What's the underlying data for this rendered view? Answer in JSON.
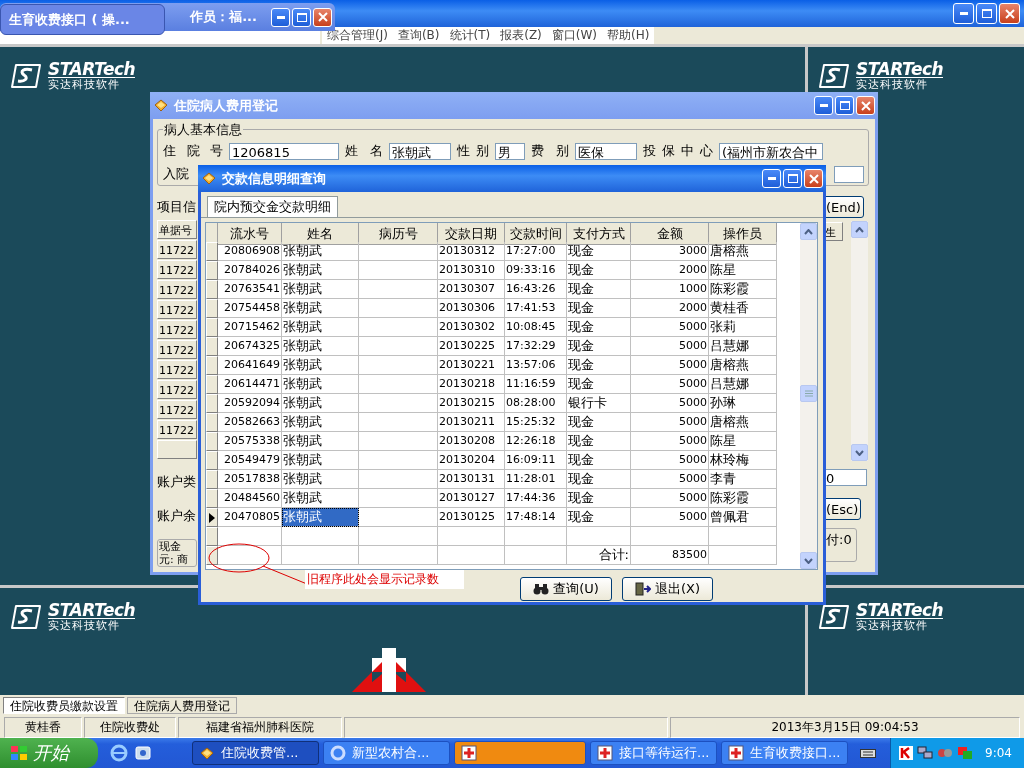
{
  "minimized_window": {
    "tooltip": "生育收费接口 ( 操...",
    "title_tail": "作员：福..."
  },
  "menu": [
    "综合管理(J)",
    "查询(B)",
    "统计(T)",
    "报表(Z)",
    "窗口(W)",
    "帮助(H)"
  ],
  "logos": [
    {
      "wordmark": "STARTech",
      "tagline": "实达科技软件"
    },
    {
      "wordmark": "STARTech",
      "tagline": "实达科技软件"
    },
    {
      "wordmark": "STARTech",
      "tagline": "实达科技软件"
    },
    {
      "wordmark": "STARTech",
      "tagline": "实达科技软件"
    }
  ],
  "fee_window": {
    "title": "住院病人费用登记",
    "group_title": "病人基本信息",
    "fields": [
      {
        "label": "住院号",
        "value": "1206815"
      },
      {
        "label": "姓名",
        "value": "张朝武"
      },
      {
        "label": "性别",
        "value": "男"
      },
      {
        "label": "费别",
        "value": "医保"
      },
      {
        "label": "投保中心",
        "value": "(福州市新农合中"
      }
    ],
    "admission_label": "入院",
    "items_label": "项目信",
    "bill_column": "单据号",
    "bill_rows": [
      "11722",
      "11722",
      "11722",
      "11722",
      "11722",
      "11722",
      "11722",
      "11722",
      "11722",
      "11722"
    ],
    "account_type_label": "账户类",
    "account_balance_label": "账户余",
    "cash_group": {
      "title": "现金",
      "text": "元: 商"
    },
    "end_button": "(End)",
    "right_column": "生",
    "right_field": "0",
    "esc_button": "(Esc)",
    "paid_text": "付:0"
  },
  "payment_dialog": {
    "title": "交款信息明细查询",
    "tab": "院内预交金交款明细",
    "columns": [
      "流水号",
      "姓名",
      "病历号",
      "交款日期",
      "交款时间",
      "支付方式",
      "金额",
      "操作员"
    ],
    "rows": [
      {
        "serial": "20806908",
        "name": "张朝武",
        "date": "20130312",
        "time": "17:27:00",
        "method": "现金",
        "amount": "3000",
        "operator": "唐榕燕",
        "selected": false
      },
      {
        "serial": "20784026",
        "name": "张朝武",
        "date": "20130310",
        "time": "09:33:16",
        "method": "现金",
        "amount": "2000",
        "operator": "陈星",
        "selected": false
      },
      {
        "serial": "20763541",
        "name": "张朝武",
        "date": "20130307",
        "time": "16:43:26",
        "method": "现金",
        "amount": "1000",
        "operator": "陈彩霞",
        "selected": false
      },
      {
        "serial": "20754458",
        "name": "张朝武",
        "date": "20130306",
        "time": "17:41:53",
        "method": "现金",
        "amount": "2000",
        "operator": "黄桂香",
        "selected": false
      },
      {
        "serial": "20715462",
        "name": "张朝武",
        "date": "20130302",
        "time": "10:08:45",
        "method": "现金",
        "amount": "5000",
        "operator": "张莉",
        "selected": false
      },
      {
        "serial": "20674325",
        "name": "张朝武",
        "date": "20130225",
        "time": "17:32:29",
        "method": "现金",
        "amount": "5000",
        "operator": "吕慧娜",
        "selected": false
      },
      {
        "serial": "20641649",
        "name": "张朝武",
        "date": "20130221",
        "time": "13:57:06",
        "method": "现金",
        "amount": "5000",
        "operator": "唐榕燕",
        "selected": false
      },
      {
        "serial": "20614471",
        "name": "张朝武",
        "date": "20130218",
        "time": "11:16:59",
        "method": "现金",
        "amount": "5000",
        "operator": "吕慧娜",
        "selected": false
      },
      {
        "serial": "20592094",
        "name": "张朝武",
        "date": "20130215",
        "time": "08:28:00",
        "method": "银行卡",
        "amount": "5000",
        "operator": "孙琳",
        "selected": false
      },
      {
        "serial": "20582663",
        "name": "张朝武",
        "date": "20130211",
        "time": "15:25:32",
        "method": "现金",
        "amount": "5000",
        "operator": "唐榕燕",
        "selected": false
      },
      {
        "serial": "20575338",
        "name": "张朝武",
        "date": "20130208",
        "time": "12:26:18",
        "method": "现金",
        "amount": "5000",
        "operator": "陈星",
        "selected": false
      },
      {
        "serial": "20549479",
        "name": "张朝武",
        "date": "20130204",
        "time": "16:09:11",
        "method": "现金",
        "amount": "5000",
        "operator": "林玲梅",
        "selected": false
      },
      {
        "serial": "20517838",
        "name": "张朝武",
        "date": "20130131",
        "time": "11:28:01",
        "method": "现金",
        "amount": "5000",
        "operator": "李青",
        "selected": false
      },
      {
        "serial": "20484560",
        "name": "张朝武",
        "date": "20130127",
        "time": "17:44:36",
        "method": "现金",
        "amount": "5000",
        "operator": "陈彩霞",
        "selected": false
      },
      {
        "serial": "20470805",
        "name": "张朝武",
        "date": "20130125",
        "time": "17:48:14",
        "method": "现金",
        "amount": "5000",
        "operator": "曾佩君",
        "selected": true
      }
    ],
    "total_label": "合计:",
    "total_value": "83500",
    "annotation": "旧程序此处会显示记录数",
    "buttons": [
      {
        "label": "查询(U)",
        "kind": "search"
      },
      {
        "label": "退出(X)",
        "kind": "exit"
      }
    ]
  },
  "mdi_tabs": [
    {
      "label": "住院收费员缴款设置",
      "selected": true
    },
    {
      "label": "住院病人费用登记",
      "selected": false
    }
  ],
  "status_bar": [
    "黄桂香",
    "住院收费处",
    "福建省福州肺科医院",
    "2013年3月15日 09:04:53"
  ],
  "taskbar": {
    "start": "开始",
    "tasks": [
      {
        "label": "住院收费管...",
        "kind": "app",
        "selected": true,
        "flashing": false
      },
      {
        "label": "新型农村合...",
        "kind": "browser",
        "selected": false,
        "flashing": false
      },
      {
        "kind": "cross",
        "selected": false,
        "flashing": true
      },
      {
        "label": "接口等待运行...",
        "kind": "cross",
        "selected": false,
        "flashing": false
      },
      {
        "label": "生育收费接口...",
        "kind": "cross",
        "selected": false,
        "flashing": false
      }
    ],
    "clock": "9:04"
  }
}
